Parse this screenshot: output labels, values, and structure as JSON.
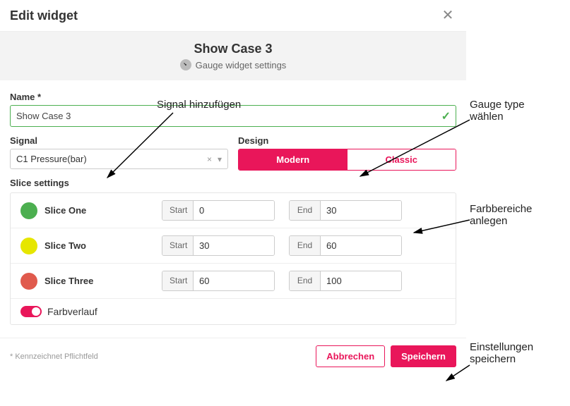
{
  "dialog": {
    "title": "Edit widget",
    "preview_title": "Show Case 3",
    "preview_subtitle": "Gauge widget settings"
  },
  "name": {
    "label": "Name *",
    "value": "Show Case 3"
  },
  "signal": {
    "label": "Signal",
    "value": "C1 Pressure(bar)"
  },
  "design": {
    "label": "Design",
    "options": {
      "modern": "Modern",
      "classic": "Classic"
    },
    "selected": "modern"
  },
  "slices": {
    "label": "Slice settings",
    "start_label": "Start",
    "end_label": "End",
    "rows": [
      {
        "name": "Slice One",
        "color": "#4caf50",
        "start": "0",
        "end": "30"
      },
      {
        "name": "Slice Two",
        "color": "#e6e600",
        "start": "30",
        "end": "60"
      },
      {
        "name": "Slice Three",
        "color": "#e05a4d",
        "start": "60",
        "end": "100"
      }
    ],
    "gradient_label": "Farbverlauf",
    "gradient_on": true
  },
  "footer": {
    "footnote": "* Kennzeichnet Pflichtfeld",
    "cancel": "Abbrechen",
    "save": "Speichern"
  },
  "annotations": {
    "add_signal": "Signal hinzufügen",
    "choose_gauge": "Gauge type wählen",
    "color_ranges": "Farbbereiche anlegen",
    "save_settings": "Einstellungen speichern"
  }
}
